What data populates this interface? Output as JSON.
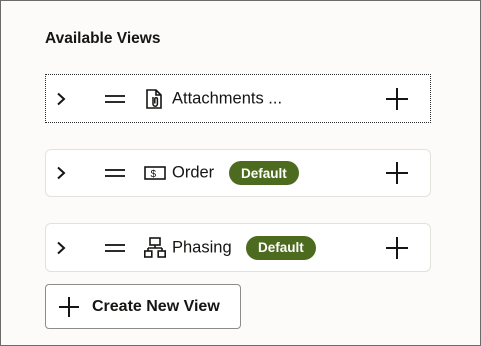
{
  "panel": {
    "title": "Available Views"
  },
  "views": [
    {
      "label": "Attachments ...",
      "badge": "",
      "icon": "attachment-document-icon"
    },
    {
      "label": "Order",
      "badge": "Default",
      "icon": "dollar-receipt-icon"
    },
    {
      "label": "Phasing",
      "badge": "Default",
      "icon": "hierarchy-icon"
    }
  ],
  "create_button": {
    "label": "Create New View"
  },
  "colors": {
    "badge_bg": "#4c6b1f",
    "badge_text": "#ffffff",
    "card_border": "#e4e1dd"
  }
}
